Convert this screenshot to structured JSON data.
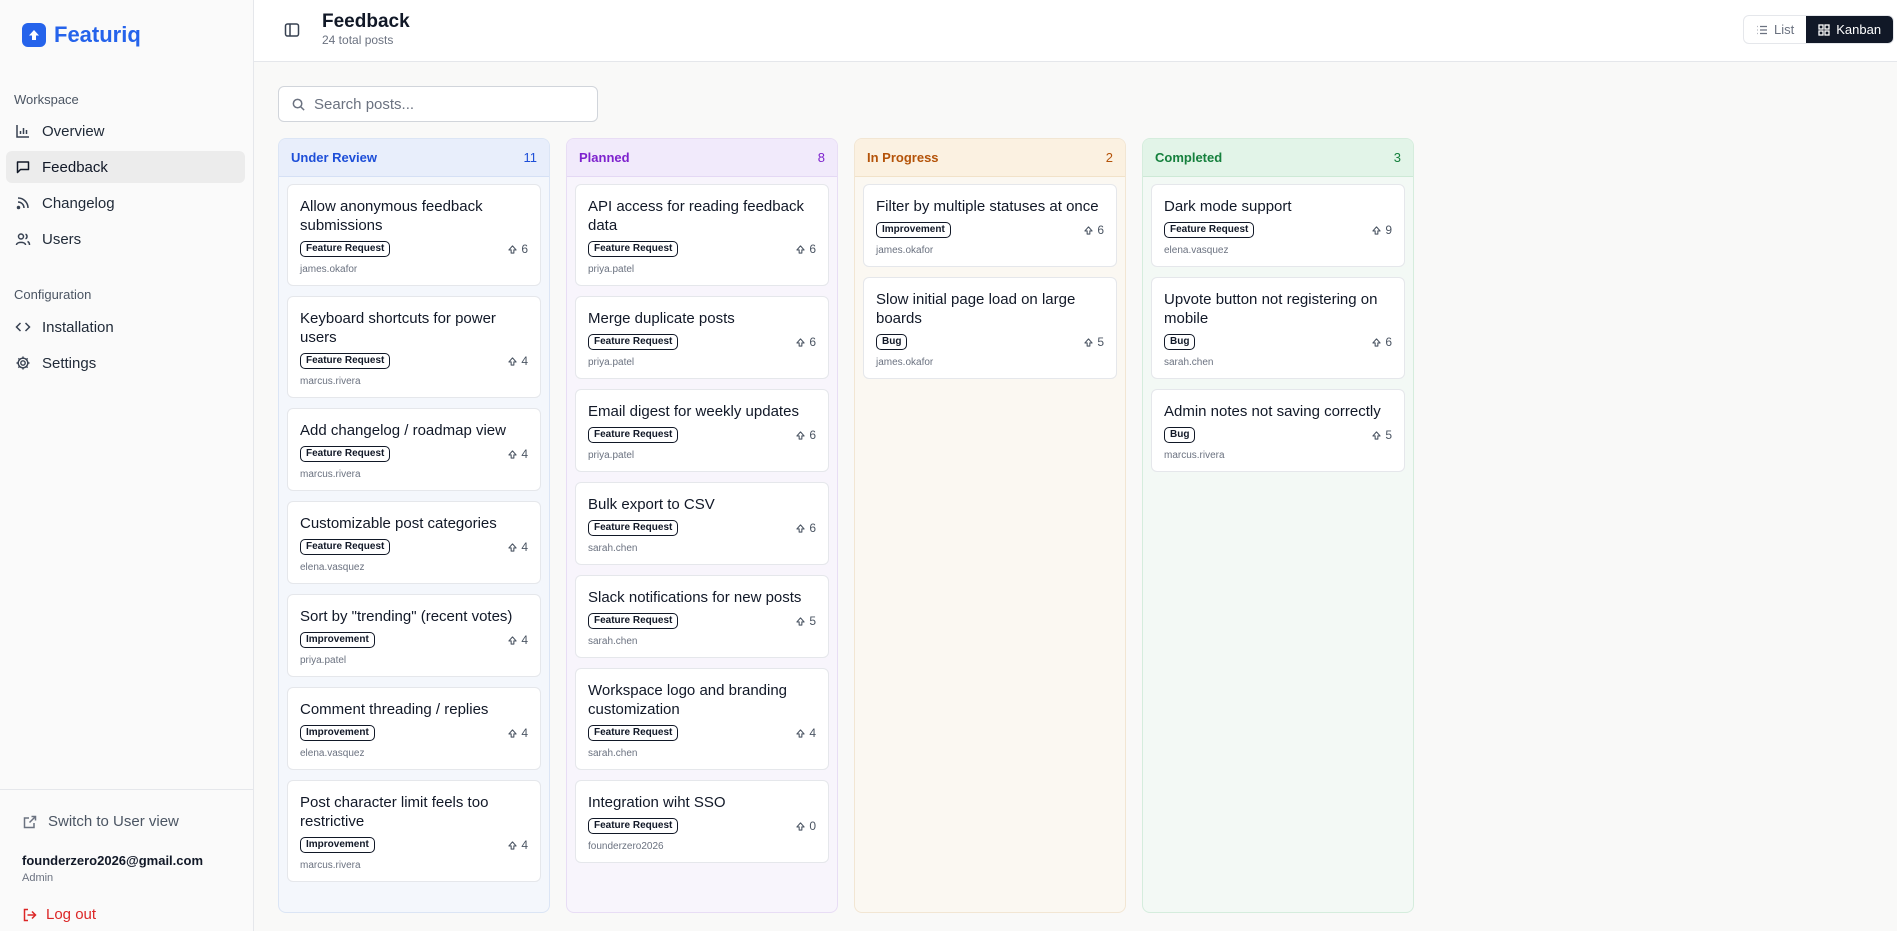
{
  "brand": {
    "name": "Featuriq"
  },
  "sidebar": {
    "workspace_label": "Workspace",
    "configuration_label": "Configuration",
    "items": [
      {
        "label": "Overview",
        "icon": "bar-chart-icon"
      },
      {
        "label": "Feedback",
        "icon": "message-square-icon",
        "active": true
      },
      {
        "label": "Changelog",
        "icon": "rss-icon"
      },
      {
        "label": "Users",
        "icon": "users-icon"
      },
      {
        "label": "Installation",
        "icon": "code-icon"
      },
      {
        "label": "Settings",
        "icon": "gear-icon"
      }
    ],
    "switch_view": "Switch to User view",
    "user_email": "founderzero2026@gmail.com",
    "user_role": "Admin",
    "logout": "Log out"
  },
  "header": {
    "title": "Feedback",
    "subtitle": "24 total posts",
    "view_list": "List",
    "view_kanban": "Kanban"
  },
  "search": {
    "placeholder": "Search posts..."
  },
  "colors": {
    "under_review": "#1d4ed8",
    "planned": "#7e22ce",
    "in_progress": "#b45309",
    "completed": "#15803d",
    "brand": "#2563eb"
  },
  "columns": [
    {
      "title": "Under Review",
      "count": "11",
      "cards": [
        {
          "title": "Allow anonymous feedback submissions",
          "tag": "Feature Request",
          "votes": "6",
          "author": "james.okafor"
        },
        {
          "title": "Keyboard shortcuts for power users",
          "tag": "Feature Request",
          "votes": "4",
          "author": "marcus.rivera"
        },
        {
          "title": "Add changelog / roadmap view",
          "tag": "Feature Request",
          "votes": "4",
          "author": "marcus.rivera"
        },
        {
          "title": "Customizable post categories",
          "tag": "Feature Request",
          "votes": "4",
          "author": "elena.vasquez"
        },
        {
          "title": "Sort by \"trending\" (recent votes)",
          "tag": "Improvement",
          "votes": "4",
          "author": "priya.patel"
        },
        {
          "title": "Comment threading / replies",
          "tag": "Improvement",
          "votes": "4",
          "author": "elena.vasquez"
        },
        {
          "title": "Post character limit feels too restrictive",
          "tag": "Improvement",
          "votes": "4",
          "author": "marcus.rivera"
        }
      ]
    },
    {
      "title": "Planned",
      "count": "8",
      "cards": [
        {
          "title": "API access for reading feedback data",
          "tag": "Feature Request",
          "votes": "6",
          "author": "priya.patel"
        },
        {
          "title": "Merge duplicate posts",
          "tag": "Feature Request",
          "votes": "6",
          "author": "priya.patel"
        },
        {
          "title": "Email digest for weekly updates",
          "tag": "Feature Request",
          "votes": "6",
          "author": "priya.patel"
        },
        {
          "title": "Bulk export to CSV",
          "tag": "Feature Request",
          "votes": "6",
          "author": "sarah.chen"
        },
        {
          "title": "Slack notifications for new posts",
          "tag": "Feature Request",
          "votes": "5",
          "author": "sarah.chen"
        },
        {
          "title": "Workspace logo and branding customization",
          "tag": "Feature Request",
          "votes": "4",
          "author": "sarah.chen"
        },
        {
          "title": "Integration wiht SSO",
          "tag": "Feature Request",
          "votes": "0",
          "author": "founderzero2026"
        }
      ]
    },
    {
      "title": "In Progress",
      "count": "2",
      "cards": [
        {
          "title": "Filter by multiple statuses at once",
          "tag": "Improvement",
          "votes": "6",
          "author": "james.okafor"
        },
        {
          "title": "Slow initial page load on large boards",
          "tag": "Bug",
          "votes": "5",
          "author": "james.okafor"
        }
      ]
    },
    {
      "title": "Completed",
      "count": "3",
      "cards": [
        {
          "title": "Dark mode support",
          "tag": "Feature Request",
          "votes": "9",
          "author": "elena.vasquez"
        },
        {
          "title": "Upvote button not registering on mobile",
          "tag": "Bug",
          "votes": "6",
          "author": "sarah.chen"
        },
        {
          "title": "Admin notes not saving correctly",
          "tag": "Bug",
          "votes": "5",
          "author": "marcus.rivera"
        }
      ]
    }
  ]
}
